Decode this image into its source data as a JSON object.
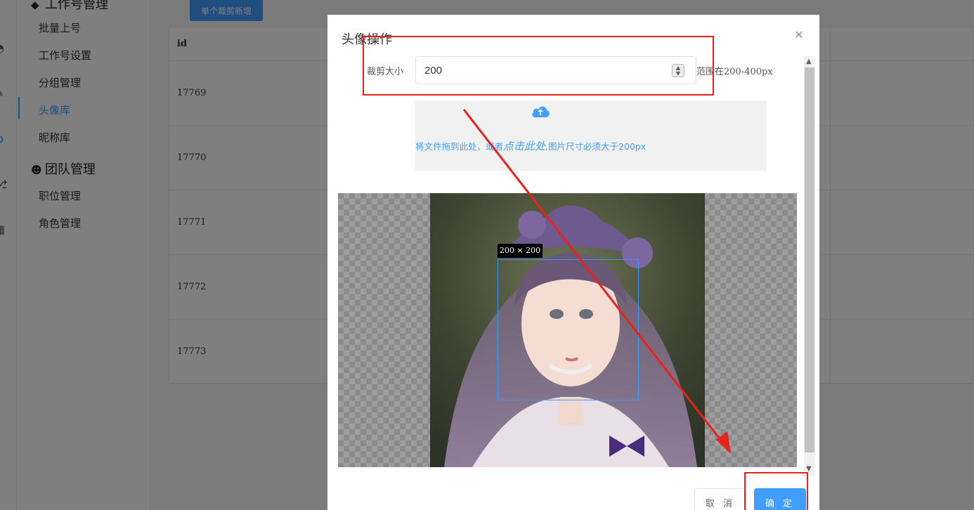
{
  "sidebar": {
    "group_partial_label": "工作号管理",
    "items_top": [
      {
        "label": "批量上号"
      },
      {
        "label": "工作号设置"
      },
      {
        "label": "分组管理"
      },
      {
        "label": "头像库",
        "active": true
      },
      {
        "label": "昵称库"
      }
    ],
    "group_team_label": "团队管理",
    "items_team": [
      {
        "label": "职位管理"
      },
      {
        "label": "角色管理"
      }
    ]
  },
  "content": {
    "add_button_label": "单个裁剪新增",
    "table": {
      "header_id": "id",
      "rows": [
        "17769",
        "17770",
        "17771",
        "17772",
        "17773"
      ]
    }
  },
  "dialog": {
    "title": "头像操作",
    "crop_size_label": "裁剪大小",
    "crop_size_value": "200",
    "range_hint": "范围在200-400px",
    "upload": {
      "text_prefix": "将文件拖到此处，或者",
      "text_link": "点击此处",
      "text_suffix": ",图片尺寸必须大于200px"
    },
    "crop_size_tag": "200 × 200",
    "cancel_label": "取 消",
    "ok_label": "确 定"
  },
  "colors": {
    "accent": "#409eff",
    "annotation_red": "#e8231b"
  }
}
